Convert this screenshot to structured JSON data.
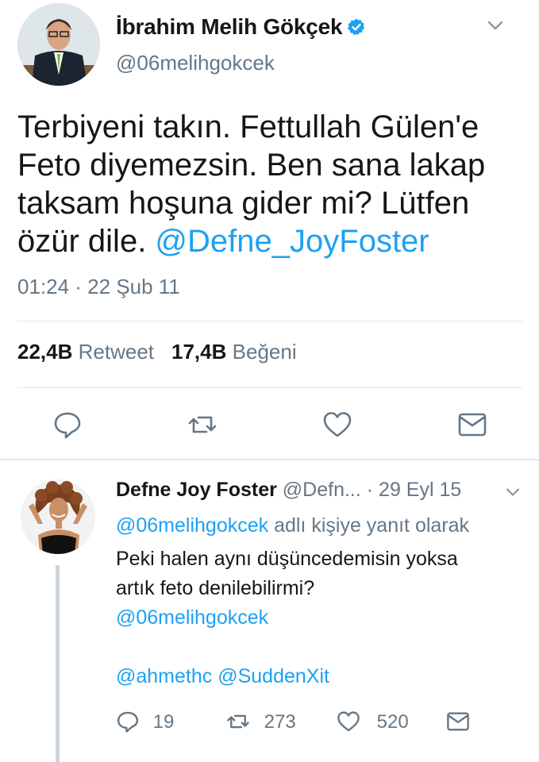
{
  "main_tweet": {
    "author_name": "İbrahim Melih Gökçek",
    "author_handle": "@06melihgokcek",
    "text": "Terbiyeni takın. Fettullah Gülen'e\nFeto diyemezsin. Ben sana lakap\ntaksam hoşuna gider mi? Lütfen\nözür dile. ",
    "mention": "@Defne_JoyFoster",
    "timestamp": "01:24 · 22 Şub 11",
    "retweet_count": "22,4B",
    "retweet_label": "Retweet",
    "like_count": "17,4B",
    "like_label": "Beğeni"
  },
  "reply": {
    "author_name": "Defne Joy Foster",
    "author_handle": "@Defn...",
    "date": "· 29 Eyl 15",
    "reply_to_handle": "@06melihgokcek",
    "reply_to_suffix": " adlı kişiye yanıt olarak",
    "text_line1": "Peki halen aynı düşüncedemisin yoksa",
    "text_line2": "artık feto denilebilirmi?",
    "mention1": "@06melihgokcek",
    "mention2": "@ahmethc",
    "mention3": "@SuddenXit",
    "reply_count": "19",
    "retweet_count": "273",
    "like_count": "520"
  },
  "colors": {
    "link": "#1da1f2",
    "muted": "#657786",
    "divider": "#e1e8ed",
    "verified": "#1da1f2"
  },
  "icons": {
    "main_actions": [
      "reply-icon",
      "retweet-icon",
      "like-icon",
      "message-icon"
    ],
    "header": [
      "verified-badge-icon",
      "chevron-down-icon"
    ]
  }
}
